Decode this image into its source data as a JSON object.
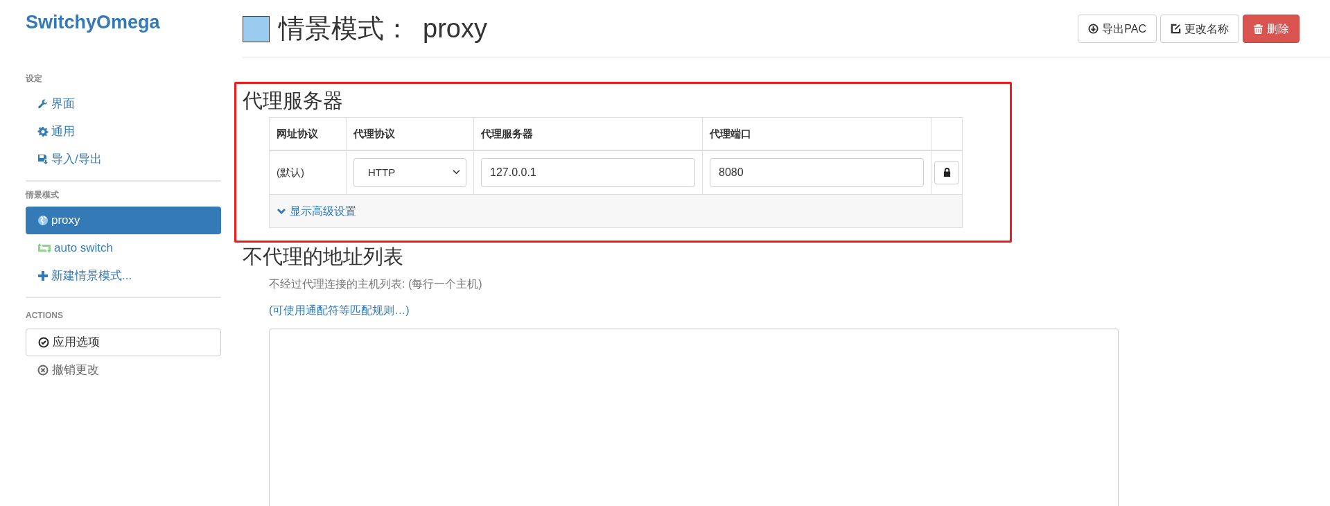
{
  "app_title": "SwitchyOmega",
  "sidebar": {
    "sections": [
      {
        "heading": "设定",
        "items": [
          {
            "label": "界面",
            "kind": "wrench",
            "selected": false
          },
          {
            "label": "通用",
            "kind": "gear",
            "selected": false
          },
          {
            "label": "导入/导出",
            "kind": "save",
            "selected": false
          }
        ]
      },
      {
        "heading": "情景模式",
        "items": [
          {
            "label": "proxy",
            "kind": "globe",
            "selected": true
          },
          {
            "label": "auto switch",
            "kind": "switch",
            "selected": false
          },
          {
            "label": "新建情景模式...",
            "kind": "plus",
            "selected": false
          }
        ]
      }
    ],
    "actions_heading": "ACTIONS",
    "actions": [
      {
        "label": "应用选项",
        "kind": "button"
      },
      {
        "label": "撤销更改",
        "kind": "link"
      }
    ]
  },
  "header": {
    "color": "#99ccee",
    "title": "情景模式：",
    "profile": "proxy",
    "buttons": [
      {
        "label": "导出PAC",
        "kind": "export"
      },
      {
        "label": "更改名称",
        "kind": "rename"
      },
      {
        "label": "删除",
        "kind": "delete"
      }
    ]
  },
  "proxy_section": {
    "heading": "代理服务器",
    "table": {
      "columns": [
        "网址协议",
        "代理协议",
        "代理服务器",
        "代理端口"
      ],
      "rows": [
        {
          "scheme": "(默认)",
          "protocol": "HTTP",
          "server": "127.0.0.1",
          "port": "8080"
        }
      ]
    },
    "advanced_link": "显示高级设置"
  },
  "bypass_section": {
    "heading": "不代理的地址列表",
    "description": "不经过代理连接的主机列表: (每行一个主机)",
    "wildcard_link": "(可使用通配符等匹配规则…)"
  }
}
